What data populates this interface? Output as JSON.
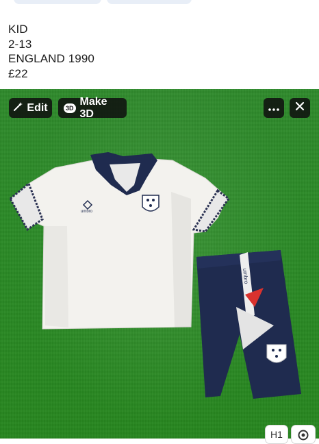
{
  "post": {
    "caption_lines": [
      "KID",
      "2-13",
      "ENGLAND 1990",
      "£22"
    ]
  },
  "photo_toolbar": {
    "edit_label": "Edit",
    "make3d_badge": "3D",
    "make3d_label": "Make 3D",
    "more_icon": "more-horizontal-icon",
    "close_icon": "close-icon"
  },
  "bottom_chips": {
    "h1_label": "H1",
    "lens_icon": "visual-search-icon"
  },
  "photo_content": {
    "shirt_brand_text": "umbro",
    "shorts_text": "umbro"
  },
  "colors": {
    "photo_background": "#2b8a27",
    "shirt": "#f3f2ee",
    "navy": "#1f2b4f",
    "button_bg": "#0f0f0f"
  }
}
